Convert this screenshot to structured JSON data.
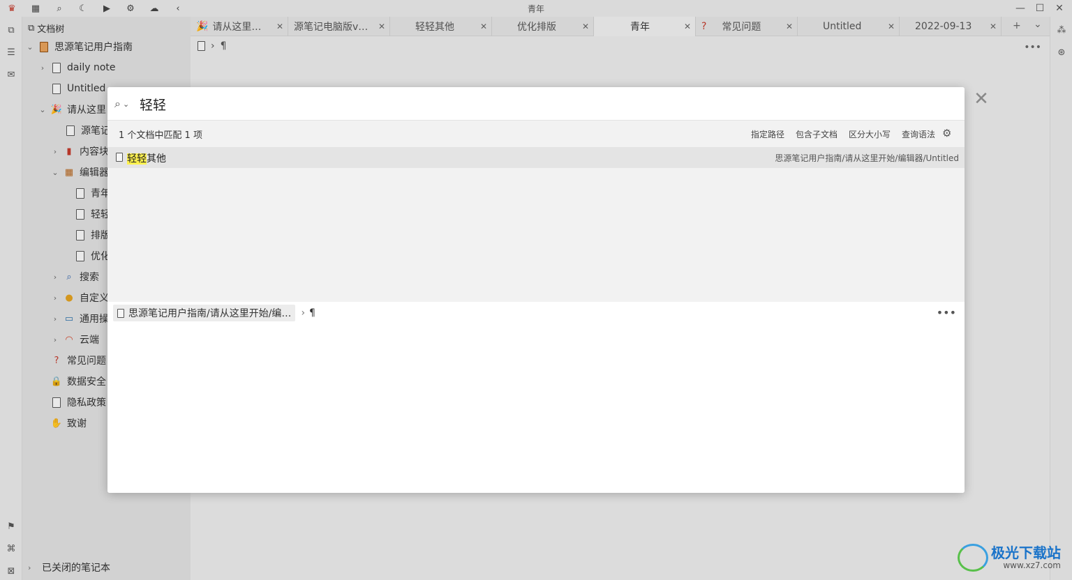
{
  "window": {
    "title": "青年",
    "toolbar_icons": [
      "logo-icon",
      "calendar-icon",
      "search-icon",
      "moon-icon",
      "video-icon",
      "gear-icon",
      "cloud-icon",
      "back-icon"
    ]
  },
  "filetree": {
    "header": "文档树",
    "items": [
      {
        "label": "思源笔记用户指南"
      },
      {
        "label": "daily note"
      },
      {
        "label": "Untitled"
      },
      {
        "label": "请从这里"
      },
      {
        "label": "源笔记"
      },
      {
        "label": "内容块"
      },
      {
        "label": "编辑器"
      },
      {
        "label": "青年"
      },
      {
        "label": "轻轻"
      },
      {
        "label": "排版"
      },
      {
        "label": "优化"
      },
      {
        "label": "搜索"
      },
      {
        "label": "自定义"
      },
      {
        "label": "通用操"
      },
      {
        "label": "云端"
      },
      {
        "label": "常见问题"
      },
      {
        "label": "数据安全"
      },
      {
        "label": "隐私政策"
      },
      {
        "label": "致谢"
      }
    ],
    "closed_notebooks": "已关闭的笔记本"
  },
  "tabs": [
    {
      "label": "请从这里…"
    },
    {
      "label": "源笔记电脑版v…"
    },
    {
      "label": "轻轻其他"
    },
    {
      "label": "优化排版"
    },
    {
      "label": "青年"
    },
    {
      "label": "常见问题"
    },
    {
      "label": "Untitled"
    },
    {
      "label": "2022-09-13"
    }
  ],
  "tabbar_controls": {
    "add": "+",
    "dropdown": "⌄"
  },
  "editor_breadcrumb": {
    "pilcrow": "¶"
  },
  "search": {
    "query": "轻轻",
    "match_summary": "1 个文档中匹配 1 项",
    "options": [
      "指定路径",
      "包含子文档",
      "区分大小写",
      "查询语法"
    ],
    "results": [
      {
        "title_highlight": "轻轻",
        "title_rest": "其他",
        "path": "思源笔记用户指南/请从这里开始/编辑器/Untitled"
      }
    ],
    "preview": {
      "breadcrumb_path": "思源笔记用户指南/请从这里开始/编…",
      "pilcrow": "¶",
      "more": "•••"
    }
  },
  "watermark": {
    "brand": "极光下载站",
    "url": "www.xz7.com"
  }
}
